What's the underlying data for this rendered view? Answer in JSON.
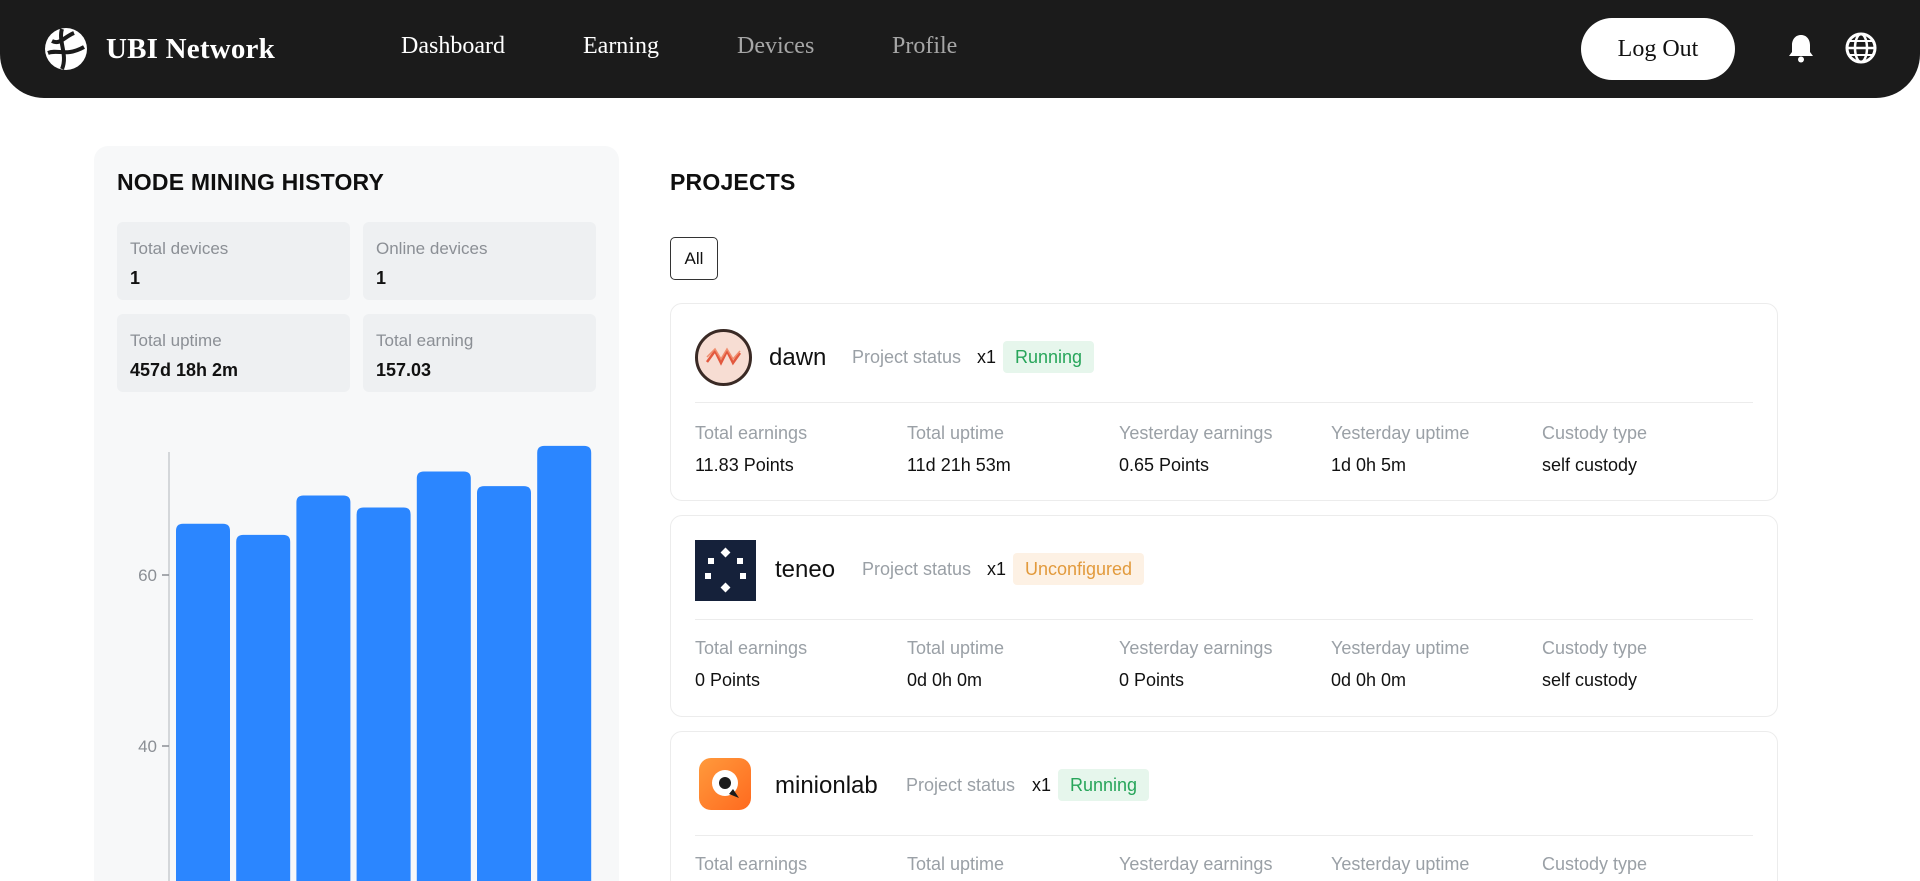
{
  "brand": {
    "name": "UBI Network",
    "logo_icon": "globe-logo-icon"
  },
  "nav": {
    "links": [
      "Dashboard",
      "Earning",
      "Devices",
      "Profile"
    ],
    "logout_label": "Log Out",
    "icons": [
      "bell-icon",
      "language-globe-icon"
    ]
  },
  "history": {
    "title": "NODE MINING HISTORY",
    "stats": [
      {
        "label": "Total devices",
        "value": "1"
      },
      {
        "label": "Online devices",
        "value": "1"
      },
      {
        "label": "Total uptime",
        "value": "457d 18h 2m"
      },
      {
        "label": "Total earning",
        "value": "157.03"
      }
    ]
  },
  "chart_data": {
    "type": "bar",
    "title": "",
    "xlabel": "",
    "ylabel": "",
    "y_ticks": [
      "40",
      "60"
    ],
    "values": [
      66,
      64.7,
      69.3,
      67.9,
      72.1,
      70.4,
      75.1
    ],
    "color": "#2b86ff"
  },
  "projects": {
    "title": "PROJECTS",
    "filter_label": "All",
    "status_label": "Project status",
    "items": [
      {
        "name": "dawn",
        "count": "x1",
        "status": "Running",
        "status_type": "running",
        "logo": "dawn-logo-icon",
        "metrics": [
          {
            "label": "Total earnings",
            "value": "11.83 Points"
          },
          {
            "label": "Total uptime",
            "value": "11d 21h 53m"
          },
          {
            "label": "Yesterday earnings",
            "value": "0.65 Points"
          },
          {
            "label": "Yesterday uptime",
            "value": "1d 0h 5m"
          },
          {
            "label": "Custody type",
            "value": "self custody"
          }
        ]
      },
      {
        "name": "teneo",
        "count": "x1",
        "status": "Unconfigured",
        "status_type": "unconf",
        "logo": "teneo-logo-icon",
        "metrics": [
          {
            "label": "Total earnings",
            "value": "0 Points"
          },
          {
            "label": "Total uptime",
            "value": "0d 0h 0m"
          },
          {
            "label": "Yesterday earnings",
            "value": "0 Points"
          },
          {
            "label": "Yesterday uptime",
            "value": "0d 0h 0m"
          },
          {
            "label": "Custody type",
            "value": "self custody"
          }
        ]
      },
      {
        "name": "minionlab",
        "count": "x1",
        "status": "Running",
        "status_type": "running",
        "logo": "minionlab-logo-icon",
        "metrics": [
          {
            "label": "Total earnings",
            "value": ""
          },
          {
            "label": "Total uptime",
            "value": ""
          },
          {
            "label": "Yesterday earnings",
            "value": ""
          },
          {
            "label": "Yesterday uptime",
            "value": ""
          },
          {
            "label": "Custody type",
            "value": ""
          }
        ]
      }
    ]
  }
}
